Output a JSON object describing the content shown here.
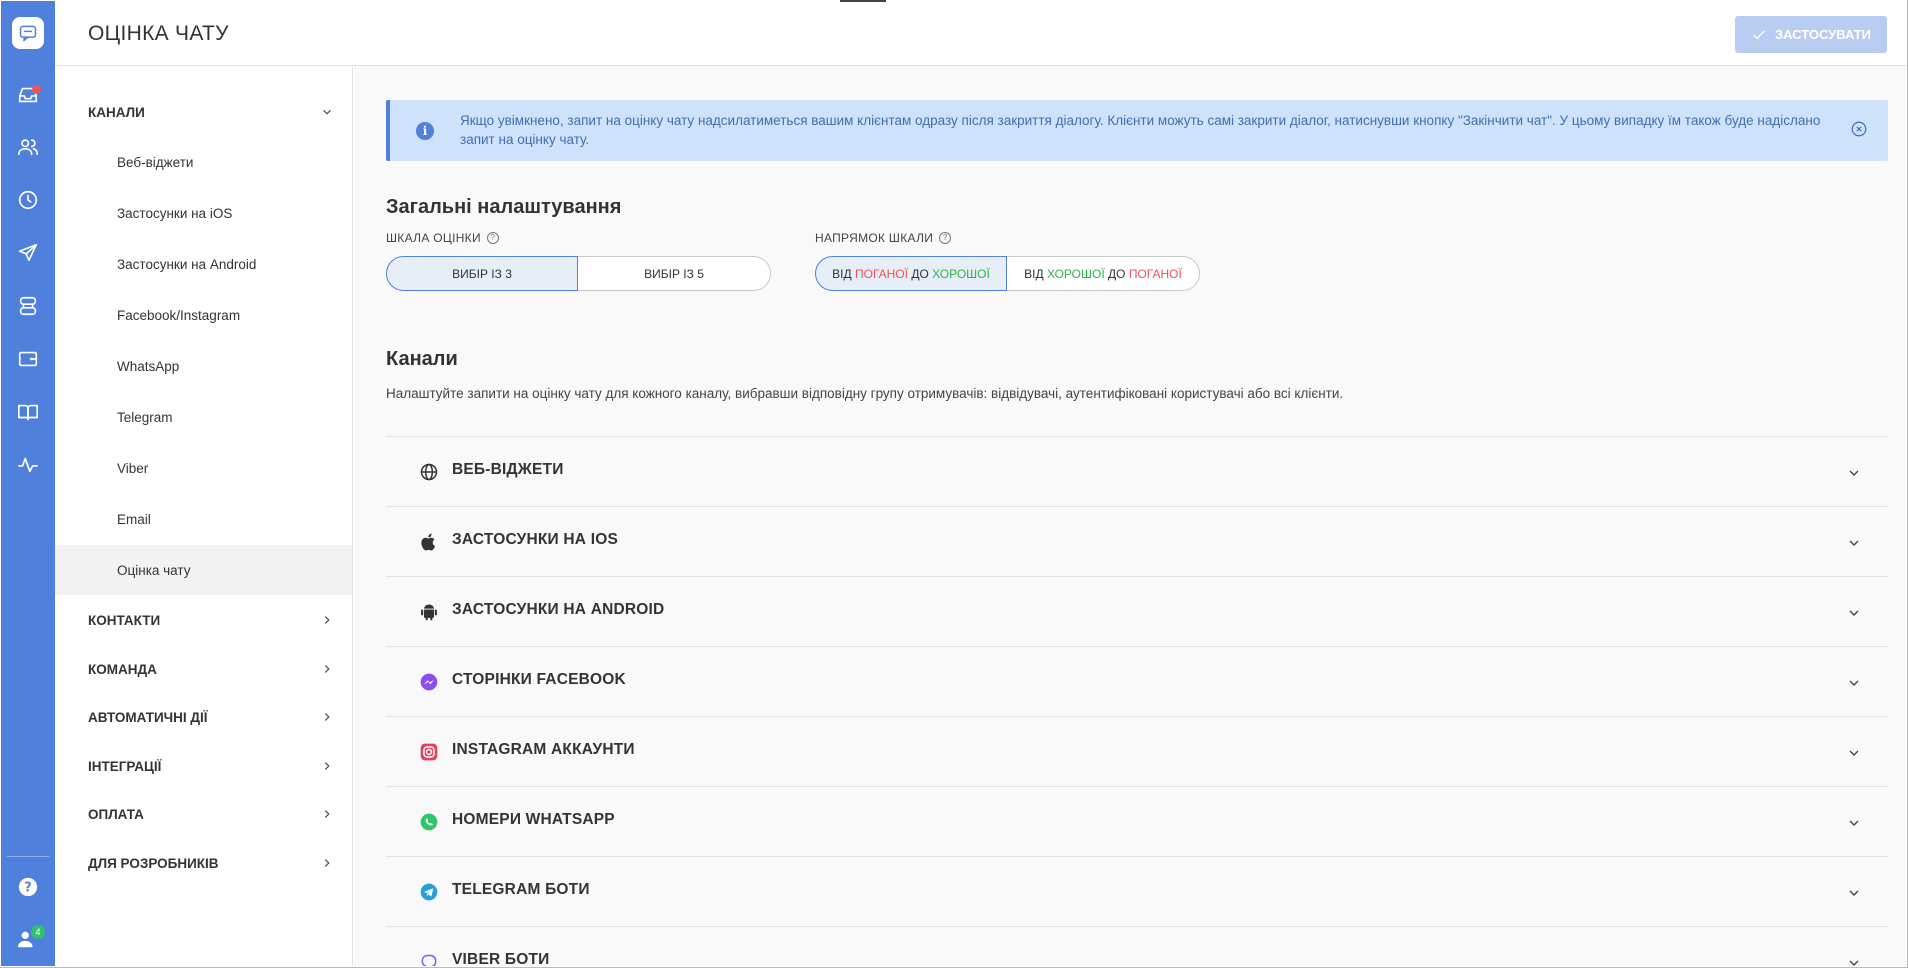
{
  "header": {
    "title": "ОЦІНКА ЧАТУ",
    "apply_label": "ЗАСТОСУВАТИ"
  },
  "rail": {
    "icons": [
      "chat-logo-icon",
      "inbox-icon",
      "contacts-icon",
      "history-icon",
      "send-icon",
      "database-icon",
      "wallet-icon",
      "book-icon",
      "activity-icon",
      "help-icon",
      "team-icon"
    ],
    "team_badge": "4",
    "accent": "#4f80dc"
  },
  "sidebar": {
    "channels": "КАНАЛИ",
    "items": [
      "Веб-віджети",
      "Застосунки на iOS",
      "Застосунки на Android",
      "Facebook/Instagram",
      "WhatsApp",
      "Telegram",
      "Viber",
      "Email",
      "Оцінка чату"
    ],
    "sections": [
      "КОНТАКТИ",
      "КОМАНДА",
      "АВТОМАТИЧНІ ДІЇ",
      "ІНТЕГРАЦІЇ",
      "ОПЛАТА",
      "ДЛЯ РОЗРОБНИКІВ"
    ]
  },
  "info": {
    "text": "Якщо увімкнено, запит на оцінку чату надсилатиметься вашим клієнтам одразу після закриття діалогу. Клієнти можуть самі закрити діалог, натиснувши кнопку \"Закінчити чат\". У цьому випадку їм також буде надіслано запит на оцінку чату."
  },
  "general": {
    "title": "Загальні налаштування",
    "scale_label": "ШКАЛА ОЦІНКИ",
    "scale_options": [
      "ВИБІР ІЗ 3",
      "ВИБІР ІЗ 5"
    ],
    "direction_label": "НАПРЯМОК ШКАЛИ",
    "dir1": {
      "from": "ВІД",
      "bad": "ПОГАНОЇ",
      "to": "ДО",
      "good": "ХОРОШОЇ"
    },
    "dir2": {
      "from": "ВІД",
      "good": "ХОРОШОЇ",
      "to": "ДО",
      "bad": "ПОГАНОЇ"
    }
  },
  "channels": {
    "title": "Канали",
    "description": "Налаштуйте запити на оцінку чату для кожного каналу, вибравши відповідну групу отримувачів: відвідувачі, аутентифіковані користувачі або всі клієнти.",
    "items": [
      "ВЕБ-ВІДЖЕТИ",
      "ЗАСТОСУНКИ НА IOS",
      "ЗАСТОСУНКИ НА ANDROID",
      "СТОРІНКИ FACEBOOK",
      "INSTAGRAM АККАУНТИ",
      "НОМЕРИ WHATSAPP",
      "TELEGRAM БОТИ",
      "VIBER БОТИ"
    ]
  }
}
